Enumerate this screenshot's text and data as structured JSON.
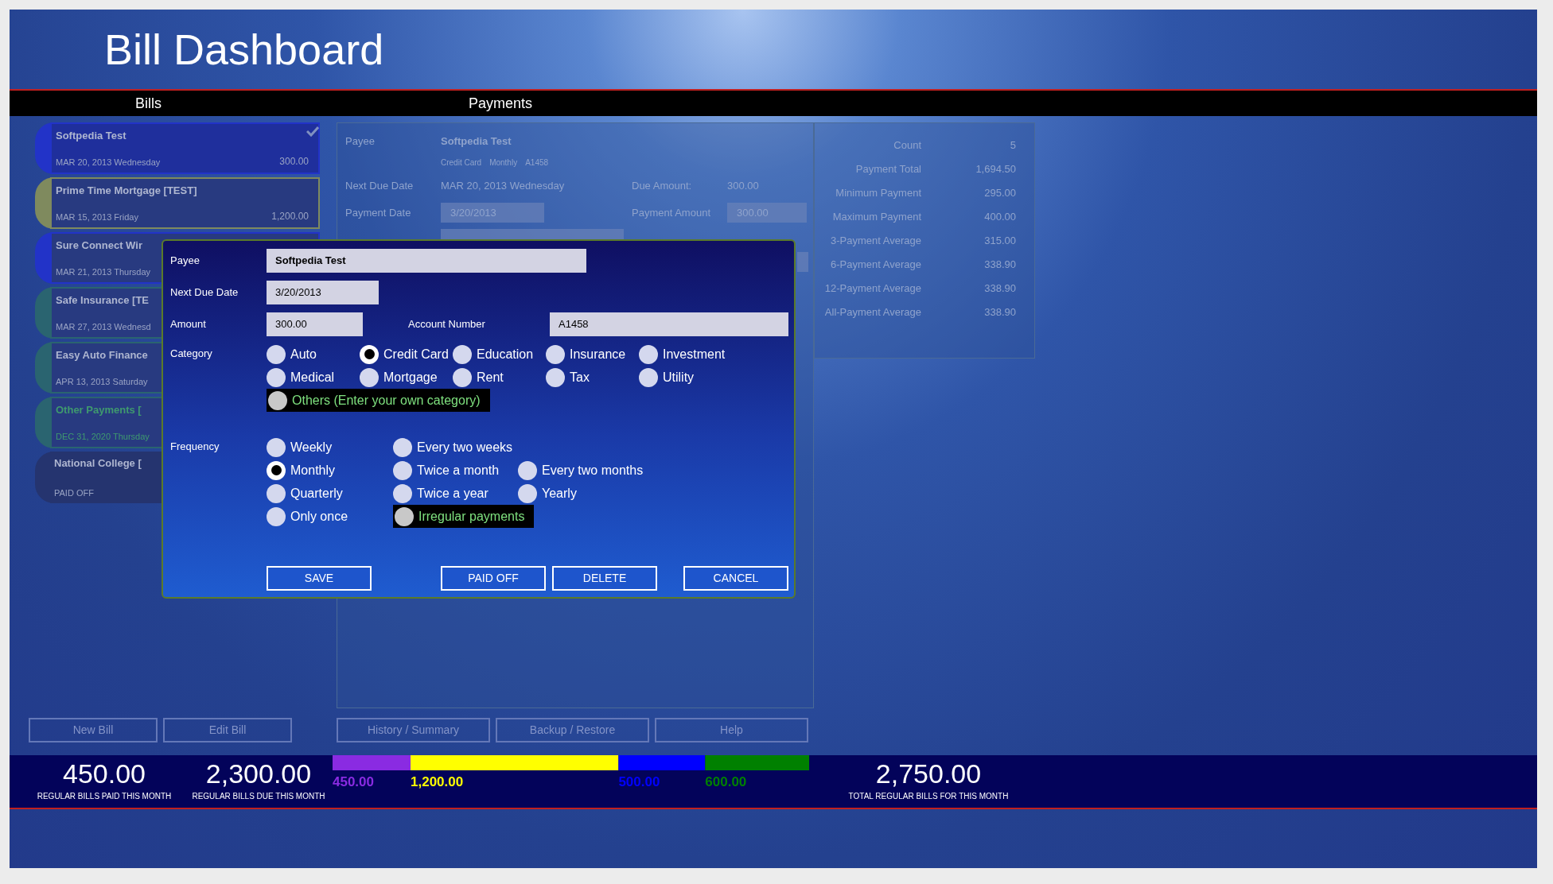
{
  "window": {
    "title": "Bill Dashboard"
  },
  "headers": [
    "Bills",
    "Payments"
  ],
  "bills": [
    {
      "name": "Softpedia Test",
      "date": "MAR 20, 2013 Wednesday",
      "amount": "300.00",
      "color": "#2233c8",
      "kind": "regular",
      "selected": true
    },
    {
      "name": "Prime Time Mortgage [TEST]",
      "date": "MAR 15, 2013 Friday",
      "amount": "1,200.00",
      "color": "#7f8a5e",
      "kind": "regular",
      "selected": false
    },
    {
      "name": "Sure Connect Wir",
      "date": "MAR 21, 2013 Thursday",
      "color": "#2233c8",
      "kind": "regular",
      "selected": false
    },
    {
      "name": "Safe Insurance [TE",
      "date": "MAR 27, 2013 Wednesd",
      "color": "#2a6470",
      "kind": "regular",
      "selected": false
    },
    {
      "name": "Easy Auto Finance",
      "date": "APR 13, 2013 Saturday",
      "color": "#2a6470",
      "kind": "regular",
      "selected": false
    },
    {
      "name": "Other Payments [",
      "date": "DEC 31, 2020 Thursday",
      "color": "#2a6470",
      "kind": "other",
      "selected": false
    },
    {
      "name": "National College [",
      "date": "PAID OFF",
      "color": "#25346f",
      "kind": "paid_off",
      "selected": false
    }
  ],
  "bill_buttons": [
    "New Bill",
    "Edit Bill"
  ],
  "payment_details": {
    "payee_label": "Payee",
    "payee": "Softpedia Test",
    "tags": [
      "Credit Card",
      "Monthly",
      "A1458"
    ],
    "next_due_label": "Next Due Date",
    "next_due": "MAR 20, 2013 Wednesday",
    "due_amount_label": "Due Amount:",
    "due_amount": "300.00",
    "payment_date_label": "Payment Date",
    "payment_date": "3/20/2013",
    "payment_amount_label": "Payment Amount",
    "payment_amount": "300.00"
  },
  "payment_buttons": [
    "History / Summary",
    "Backup / Restore",
    "Help"
  ],
  "statistics": [
    {
      "label": "Count",
      "value": "5"
    },
    {
      "label": "Payment Total",
      "value": "1,694.50"
    },
    {
      "label": "Minimum Payment",
      "value": "295.00"
    },
    {
      "label": "Maximum Payment",
      "value": "400.00"
    },
    {
      "label": "3-Payment Average",
      "value": "315.00"
    },
    {
      "label": "6-Payment Average",
      "value": "338.90"
    },
    {
      "label": "12-Payment Average",
      "value": "338.90"
    },
    {
      "label": "All-Payment Average",
      "value": "338.90"
    }
  ],
  "summary": {
    "paid": {
      "value": "450.00",
      "label": "REGULAR BILLS PAID THIS MONTH"
    },
    "due": {
      "value": "2,300.00",
      "label": "REGULAR BILLS DUE THIS MONTH"
    },
    "total": {
      "value": "2,750.00",
      "label": "TOTAL REGULAR BILLS FOR THIS MONTH"
    },
    "chart_data": {
      "type": "bar",
      "orientation": "horizontal",
      "stacked": true,
      "series": [
        {
          "color": "#8a2be2",
          "values": [
            450
          ],
          "value_labels": [
            "450.00"
          ]
        },
        {
          "color": "#ffff00",
          "values": [
            1200
          ],
          "value_labels": [
            "1,200.00"
          ]
        },
        {
          "color": "#0000ff",
          "values": [
            500
          ],
          "value_labels": [
            "500.00"
          ]
        },
        {
          "color": "#008000",
          "values": [
            600
          ],
          "value_labels": [
            "600.00"
          ]
        }
      ]
    }
  },
  "dialog": {
    "payee": {
      "label": "Payee",
      "value": "Softpedia Test"
    },
    "next_due_date": {
      "label": "Next Due Date",
      "value": "3/20/2013"
    },
    "amount": {
      "label": "Amount",
      "value": "300.00"
    },
    "account_number": {
      "label": "Account Number",
      "value": "A1458"
    },
    "category": {
      "label": "Category",
      "rows": [
        [
          {
            "label": "Auto",
            "selected": false,
            "highlighted": false
          },
          {
            "label": "Credit Card",
            "selected": true,
            "highlighted": false
          },
          {
            "label": "Education",
            "selected": false,
            "highlighted": false
          },
          {
            "label": "Insurance",
            "selected": false,
            "highlighted": false
          },
          {
            "label": "Investment",
            "selected": false,
            "highlighted": false
          }
        ],
        [
          {
            "label": "Medical",
            "selected": false,
            "highlighted": false
          },
          {
            "label": "Mortgage",
            "selected": false,
            "highlighted": false
          },
          {
            "label": "Rent",
            "selected": false,
            "highlighted": false
          },
          {
            "label": "Tax",
            "selected": false,
            "highlighted": false
          },
          {
            "label": "Utility",
            "selected": false,
            "highlighted": false
          }
        ],
        [
          {
            "label": "Others (Enter your own category)",
            "selected": false,
            "highlighted": true
          }
        ]
      ]
    },
    "frequency": {
      "label": "Frequency",
      "rows": [
        [
          {
            "label": "Weekly",
            "selected": false,
            "highlighted": false
          },
          {
            "label": "Every two weeks",
            "selected": false,
            "highlighted": false
          }
        ],
        [
          {
            "label": "Monthly",
            "selected": true,
            "highlighted": false
          },
          {
            "label": "Twice a month",
            "selected": false,
            "highlighted": false
          },
          {
            "label": "Every two months",
            "selected": false,
            "highlighted": false
          }
        ],
        [
          {
            "label": "Quarterly",
            "selected": false,
            "highlighted": false
          },
          {
            "label": "Twice a year",
            "selected": false,
            "highlighted": false
          },
          {
            "label": "Yearly",
            "selected": false,
            "highlighted": false
          }
        ],
        [
          {
            "label": "Only once",
            "selected": false,
            "highlighted": false
          },
          {
            "label": "Irregular payments",
            "selected": false,
            "highlighted": true
          }
        ]
      ]
    },
    "buttons": [
      "SAVE",
      "PAID OFF",
      "DELETE",
      "CANCEL"
    ]
  }
}
